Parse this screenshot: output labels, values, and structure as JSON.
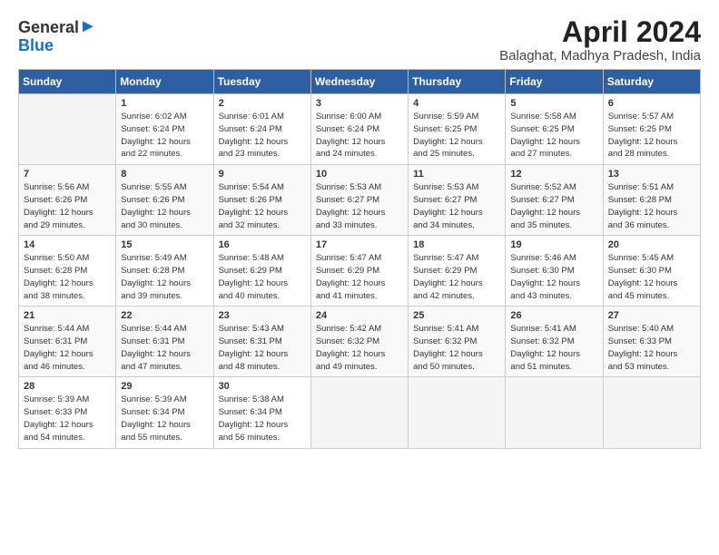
{
  "header": {
    "logo_general": "General",
    "logo_blue": "Blue",
    "title": "April 2024",
    "subtitle": "Balaghat, Madhya Pradesh, India"
  },
  "columns": [
    "Sunday",
    "Monday",
    "Tuesday",
    "Wednesday",
    "Thursday",
    "Friday",
    "Saturday"
  ],
  "weeks": [
    [
      {
        "num": "",
        "empty": true
      },
      {
        "num": "1",
        "sunrise": "6:02 AM",
        "sunset": "6:24 PM",
        "daylight": "12 hours and 22 minutes."
      },
      {
        "num": "2",
        "sunrise": "6:01 AM",
        "sunset": "6:24 PM",
        "daylight": "12 hours and 23 minutes."
      },
      {
        "num": "3",
        "sunrise": "6:00 AM",
        "sunset": "6:24 PM",
        "daylight": "12 hours and 24 minutes."
      },
      {
        "num": "4",
        "sunrise": "5:59 AM",
        "sunset": "6:25 PM",
        "daylight": "12 hours and 25 minutes."
      },
      {
        "num": "5",
        "sunrise": "5:58 AM",
        "sunset": "6:25 PM",
        "daylight": "12 hours and 27 minutes."
      },
      {
        "num": "6",
        "sunrise": "5:57 AM",
        "sunset": "6:25 PM",
        "daylight": "12 hours and 28 minutes."
      }
    ],
    [
      {
        "num": "7",
        "sunrise": "5:56 AM",
        "sunset": "6:26 PM",
        "daylight": "12 hours and 29 minutes."
      },
      {
        "num": "8",
        "sunrise": "5:55 AM",
        "sunset": "6:26 PM",
        "daylight": "12 hours and 30 minutes."
      },
      {
        "num": "9",
        "sunrise": "5:54 AM",
        "sunset": "6:26 PM",
        "daylight": "12 hours and 32 minutes."
      },
      {
        "num": "10",
        "sunrise": "5:53 AM",
        "sunset": "6:27 PM",
        "daylight": "12 hours and 33 minutes."
      },
      {
        "num": "11",
        "sunrise": "5:53 AM",
        "sunset": "6:27 PM",
        "daylight": "12 hours and 34 minutes."
      },
      {
        "num": "12",
        "sunrise": "5:52 AM",
        "sunset": "6:27 PM",
        "daylight": "12 hours and 35 minutes."
      },
      {
        "num": "13",
        "sunrise": "5:51 AM",
        "sunset": "6:28 PM",
        "daylight": "12 hours and 36 minutes."
      }
    ],
    [
      {
        "num": "14",
        "sunrise": "5:50 AM",
        "sunset": "6:28 PM",
        "daylight": "12 hours and 38 minutes."
      },
      {
        "num": "15",
        "sunrise": "5:49 AM",
        "sunset": "6:28 PM",
        "daylight": "12 hours and 39 minutes."
      },
      {
        "num": "16",
        "sunrise": "5:48 AM",
        "sunset": "6:29 PM",
        "daylight": "12 hours and 40 minutes."
      },
      {
        "num": "17",
        "sunrise": "5:47 AM",
        "sunset": "6:29 PM",
        "daylight": "12 hours and 41 minutes."
      },
      {
        "num": "18",
        "sunrise": "5:47 AM",
        "sunset": "6:29 PM",
        "daylight": "12 hours and 42 minutes."
      },
      {
        "num": "19",
        "sunrise": "5:46 AM",
        "sunset": "6:30 PM",
        "daylight": "12 hours and 43 minutes."
      },
      {
        "num": "20",
        "sunrise": "5:45 AM",
        "sunset": "6:30 PM",
        "daylight": "12 hours and 45 minutes."
      }
    ],
    [
      {
        "num": "21",
        "sunrise": "5:44 AM",
        "sunset": "6:31 PM",
        "daylight": "12 hours and 46 minutes."
      },
      {
        "num": "22",
        "sunrise": "5:44 AM",
        "sunset": "6:31 PM",
        "daylight": "12 hours and 47 minutes."
      },
      {
        "num": "23",
        "sunrise": "5:43 AM",
        "sunset": "6:31 PM",
        "daylight": "12 hours and 48 minutes."
      },
      {
        "num": "24",
        "sunrise": "5:42 AM",
        "sunset": "6:32 PM",
        "daylight": "12 hours and 49 minutes."
      },
      {
        "num": "25",
        "sunrise": "5:41 AM",
        "sunset": "6:32 PM",
        "daylight": "12 hours and 50 minutes."
      },
      {
        "num": "26",
        "sunrise": "5:41 AM",
        "sunset": "6:32 PM",
        "daylight": "12 hours and 51 minutes."
      },
      {
        "num": "27",
        "sunrise": "5:40 AM",
        "sunset": "6:33 PM",
        "daylight": "12 hours and 53 minutes."
      }
    ],
    [
      {
        "num": "28",
        "sunrise": "5:39 AM",
        "sunset": "6:33 PM",
        "daylight": "12 hours and 54 minutes."
      },
      {
        "num": "29",
        "sunrise": "5:39 AM",
        "sunset": "6:34 PM",
        "daylight": "12 hours and 55 minutes."
      },
      {
        "num": "30",
        "sunrise": "5:38 AM",
        "sunset": "6:34 PM",
        "daylight": "12 hours and 56 minutes."
      },
      {
        "num": "",
        "empty": true
      },
      {
        "num": "",
        "empty": true
      },
      {
        "num": "",
        "empty": true
      },
      {
        "num": "",
        "empty": true
      }
    ]
  ]
}
